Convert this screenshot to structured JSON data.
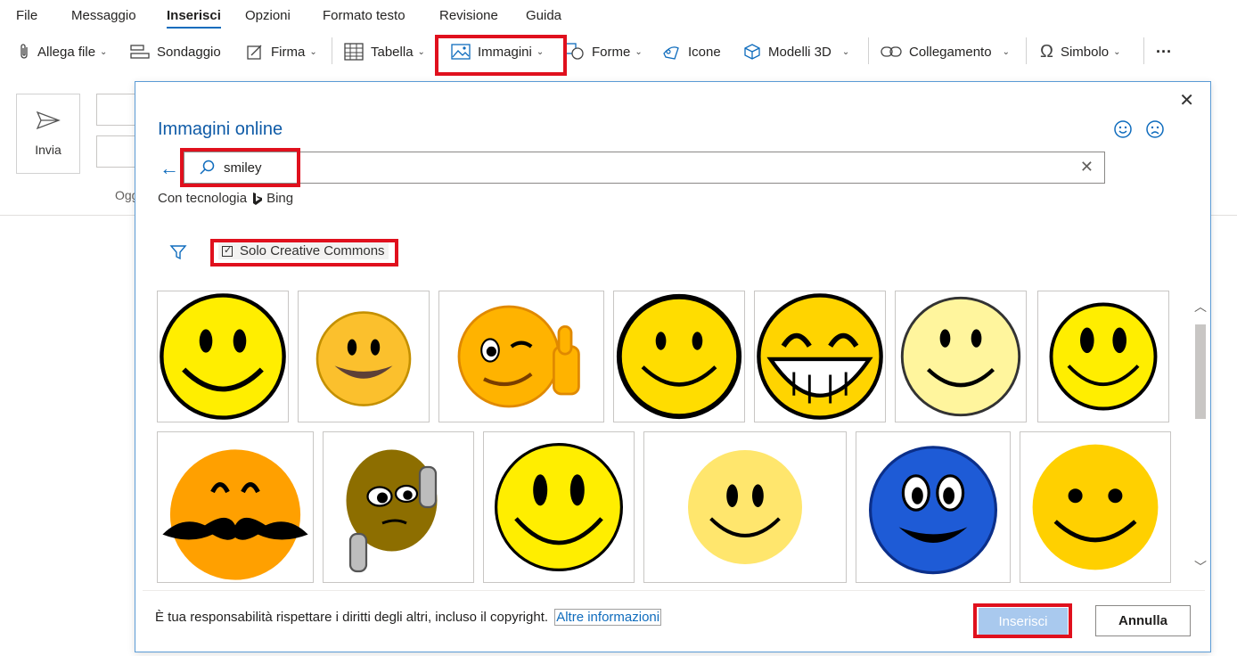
{
  "menu": [
    {
      "label": "File"
    },
    {
      "label": "Messaggio"
    },
    {
      "label": "Inserisci",
      "active": true
    },
    {
      "label": "Opzioni"
    },
    {
      "label": "Formato testo"
    },
    {
      "label": "Revisione"
    },
    {
      "label": "Guida"
    }
  ],
  "toolbar": {
    "allega": "Allega file",
    "sondaggio": "Sondaggio",
    "firma": "Firma",
    "tabella": "Tabella",
    "immagini": "Immagini",
    "forme": "Forme",
    "icone": "Icone",
    "modelli3d": "Modelli 3D",
    "collegamento": "Collegamento",
    "simbolo": "Simbolo",
    "more": "···"
  },
  "compose": {
    "send_label": "Invia",
    "subject_partial": "Ogg"
  },
  "dialog": {
    "title": "Immagini online",
    "search_value": "smiley",
    "powered_by": "Con tecnologia",
    "bing": "Bing",
    "creative_commons": "Solo Creative Commons",
    "creative_commons_checked": true,
    "notice": "È tua responsabilità rispettare i diritti degli altri, incluso il copyright.",
    "more_info": "Altre informazioni",
    "insert": "Inserisci",
    "cancel": "Annulla",
    "close": "✕"
  },
  "colors": {
    "accent": "#0f6cbd",
    "highlight_red": "#e0101d",
    "smiley_yellow": "#ffee00"
  },
  "results": [
    {
      "name": "smiley-classic-yellow"
    },
    {
      "name": "smiley-glossy-orange"
    },
    {
      "name": "smiley-wink-thumbs-up"
    },
    {
      "name": "smiley-bold-outline"
    },
    {
      "name": "smiley-laughing"
    },
    {
      "name": "smiley-pale-yellow"
    },
    {
      "name": "smiley-simple"
    },
    {
      "name": "smiley-mustache"
    },
    {
      "name": "smiley-thinking-brown"
    },
    {
      "name": "smiley-classic-large"
    },
    {
      "name": "smiley-soft-gradient"
    },
    {
      "name": "smiley-blue-3d"
    },
    {
      "name": "smiley-gold-glossy"
    }
  ]
}
